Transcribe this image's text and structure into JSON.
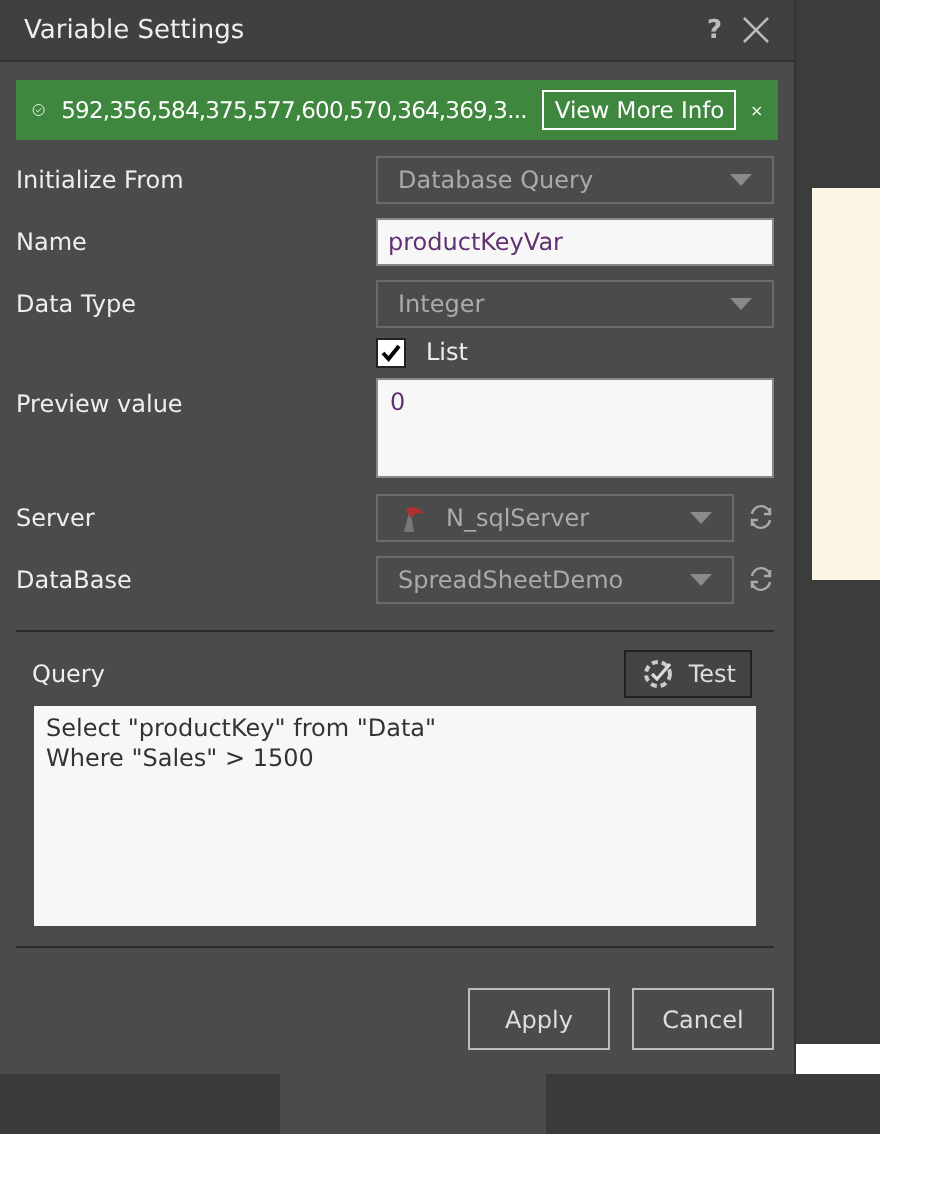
{
  "window": {
    "title": "Variable Settings",
    "help": "?"
  },
  "banner": {
    "text": "592,356,584,375,577,600,570,364,369,3...",
    "button": "View More Info"
  },
  "fields": [
    {
      "kind": "select",
      "label": "Initialize From",
      "value": "Database Query"
    },
    {
      "kind": "text",
      "label": "Name",
      "value": "productKeyVar"
    },
    {
      "kind": "select",
      "label": "Data Type",
      "value": "Integer"
    },
    {
      "kind": "checkbox",
      "label": "List",
      "checked": true
    },
    {
      "kind": "textarea",
      "label": "Preview value",
      "value": "0"
    },
    {
      "kind": "server_select",
      "label": "Server",
      "value": "N_sqlServer"
    },
    {
      "kind": "select_refresh",
      "label": "DataBase",
      "value": "SpreadSheetDemo"
    }
  ],
  "query": {
    "label": "Query",
    "test_button": "Test",
    "lines": [
      "Select \"productKey\" from \"Data\"",
      "Where \"Sales\" > 1500"
    ]
  },
  "buttons": [
    "Apply",
    "Cancel"
  ]
}
